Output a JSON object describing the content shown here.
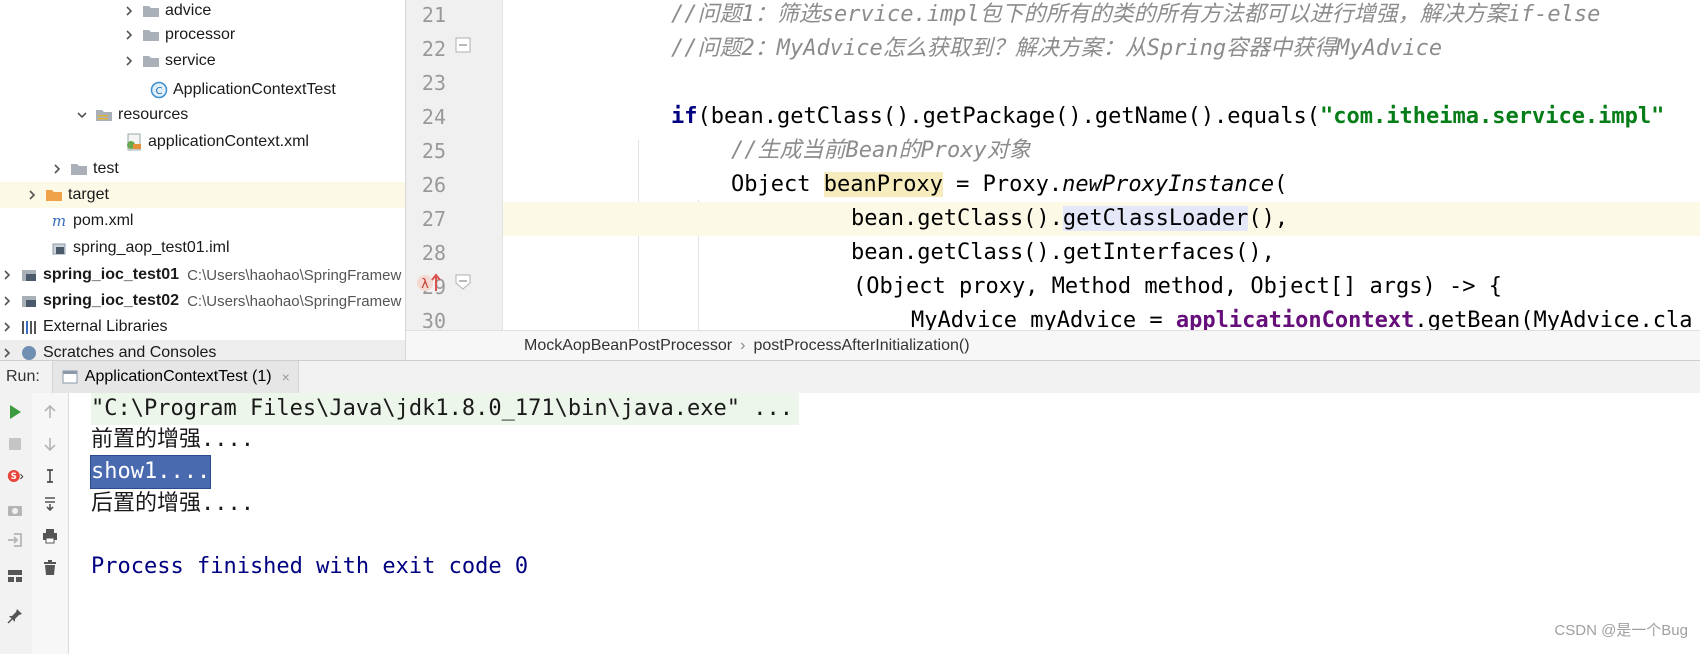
{
  "tree": {
    "items": [
      {
        "label": "advice",
        "type": "folder",
        "expanded": false
      },
      {
        "label": "processor",
        "type": "folder",
        "expanded": false
      },
      {
        "label": "service",
        "type": "folder",
        "expanded": false
      },
      {
        "label": "ApplicationContextTest",
        "type": "java-class"
      },
      {
        "label": "resources",
        "type": "resources-folder",
        "expanded": true
      },
      {
        "label": "applicationContext.xml",
        "type": "xml-file"
      },
      {
        "label": "test",
        "type": "folder",
        "expanded": false
      },
      {
        "label": "target",
        "type": "excluded-folder",
        "expanded": false,
        "selected": true
      },
      {
        "label": "pom.xml",
        "type": "maven-file"
      },
      {
        "label": "spring_aop_test01.iml",
        "type": "iml-file"
      },
      {
        "label": "spring_ioc_test01",
        "path": "C:\\Users\\haohao\\SpringFramew",
        "type": "module"
      },
      {
        "label": "spring_ioc_test02",
        "path": "C:\\Users\\haohao\\SpringFramew",
        "type": "module"
      },
      {
        "label": "External Libraries",
        "type": "libraries"
      },
      {
        "label": "Scratches and Consoles",
        "type": "scratches"
      }
    ]
  },
  "editor": {
    "line_numbers": [
      "21",
      "22",
      "23",
      "24",
      "25",
      "26",
      "27",
      "28",
      "29",
      "30"
    ],
    "code": {
      "l21": "//问题1：筛选service.impl包下的所有的类的所有方法都可以进行增强，解决方案if-else",
      "l22": "//问题2：MyAdvice怎么获取到？解决方案：从Spring容器中获得MyAdvice",
      "l24_kw": "if",
      "l24_a": "(bean.getClass().getPackage().getName().equals(",
      "l24_str": "\"com.itheima.service.impl\"",
      "l25": "//生成当前Bean的Proxy对象",
      "l26_a": "Object ",
      "l26_var": "beanProxy",
      "l26_b": " = Proxy.",
      "l26_it": "newProxyInstance",
      "l26_c": "(",
      "l27_a": "bean.getClass().",
      "l27_sel": "getClassLoader",
      "l27_b": "(),",
      "l28": "bean.getClass().getInterfaces(),",
      "l29": "(Object proxy, Method method, Object[] args) -> {",
      "l30_a": "MyAdvice myAdvice = ",
      "l30_fld": "applicationContext",
      "l30_b": ".getBean(MyAdvice.cla"
    },
    "current_line": "27"
  },
  "breadcrumb": {
    "class_name": "MockAopBeanPostProcessor",
    "separator": "›",
    "method": "postProcessAfterInitialization()"
  },
  "run": {
    "label": "Run:",
    "tab": "ApplicationContextTest (1)",
    "tab_close": "×",
    "output": {
      "cmd": "\"C:\\Program Files\\Java\\jdk1.8.0_171\\bin\\java.exe\" ...",
      "before": "前置的增强....",
      "show": "show1....",
      "after": "后置的增强....",
      "exit": "Process finished with exit code 0"
    }
  },
  "watermark": "CSDN @是一个Bug",
  "colors": {
    "keyword": "#000080",
    "string": "#067d17",
    "comment": "#8c8c8c",
    "field": "#660e7a",
    "selection": "#4a6ab0",
    "current_line": "#fcfae6"
  }
}
